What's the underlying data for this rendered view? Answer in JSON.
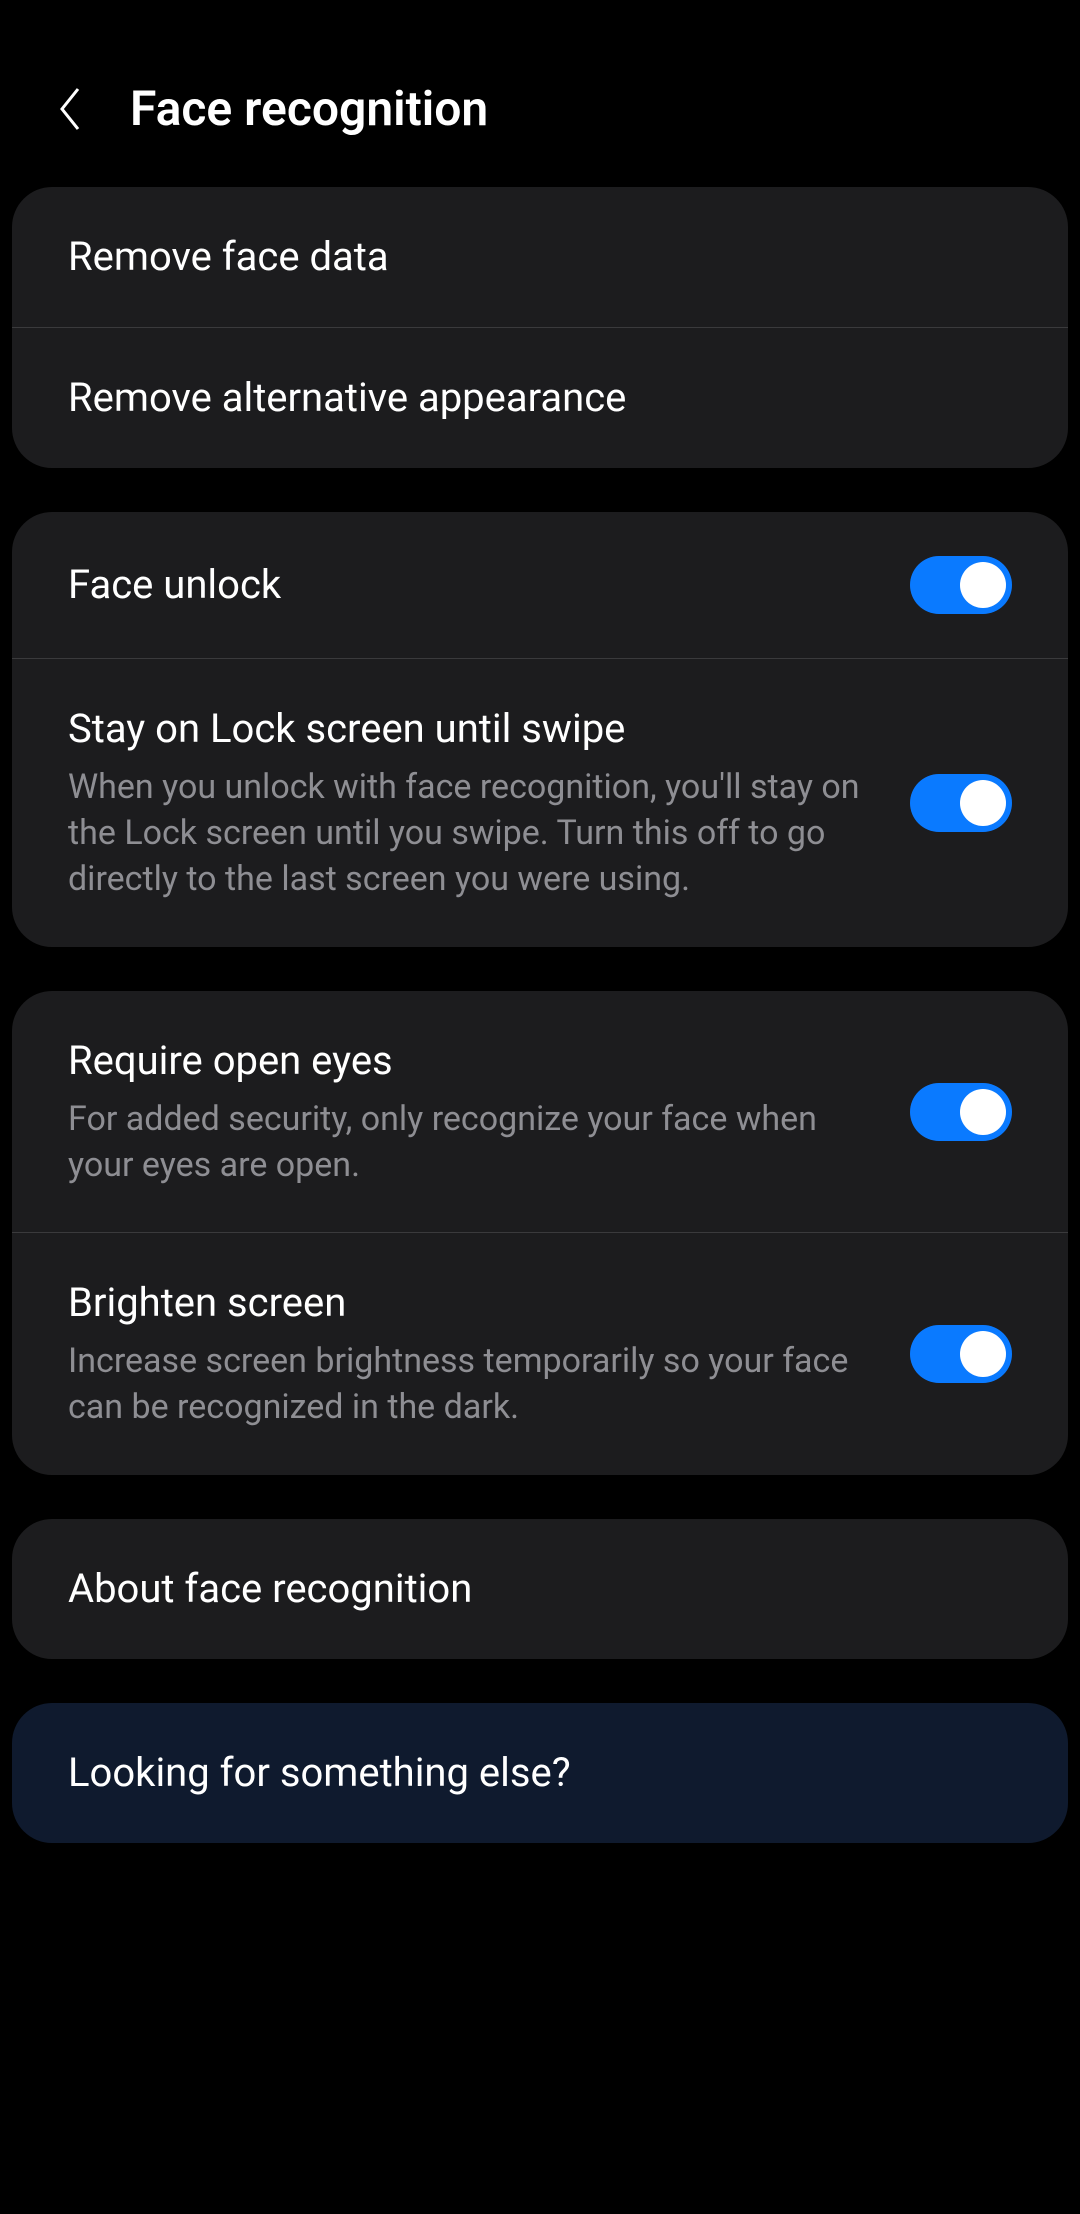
{
  "header": {
    "title": "Face recognition"
  },
  "groups": [
    {
      "items": [
        {
          "id": "remove-face-data",
          "title": "Remove face data",
          "hasToggle": false
        },
        {
          "id": "remove-alternative-appearance",
          "title": "Remove alternative appearance",
          "hasToggle": false
        }
      ]
    },
    {
      "items": [
        {
          "id": "face-unlock",
          "title": "Face unlock",
          "hasToggle": true,
          "toggleOn": true
        },
        {
          "id": "stay-on-lock-screen",
          "title": "Stay on Lock screen until swipe",
          "description": "When you unlock with face recognition, you'll stay on the Lock screen until you swipe. Turn this off to go directly to the last screen you were using.",
          "hasToggle": true,
          "toggleOn": true
        }
      ]
    },
    {
      "items": [
        {
          "id": "require-open-eyes",
          "title": "Require open eyes",
          "description": "For added security, only recognize your face when your eyes are open.",
          "hasToggle": true,
          "toggleOn": true
        },
        {
          "id": "brighten-screen",
          "title": "Brighten screen",
          "description": "Increase screen brightness temporarily so your face can be recognized in the dark.",
          "hasToggle": true,
          "toggleOn": true
        }
      ]
    },
    {
      "items": [
        {
          "id": "about-face-recognition",
          "title": "About face recognition",
          "hasToggle": false
        }
      ]
    },
    {
      "dark": true,
      "items": [
        {
          "id": "looking-for-else",
          "title": "Looking for something else?",
          "hasToggle": false
        }
      ]
    }
  ]
}
